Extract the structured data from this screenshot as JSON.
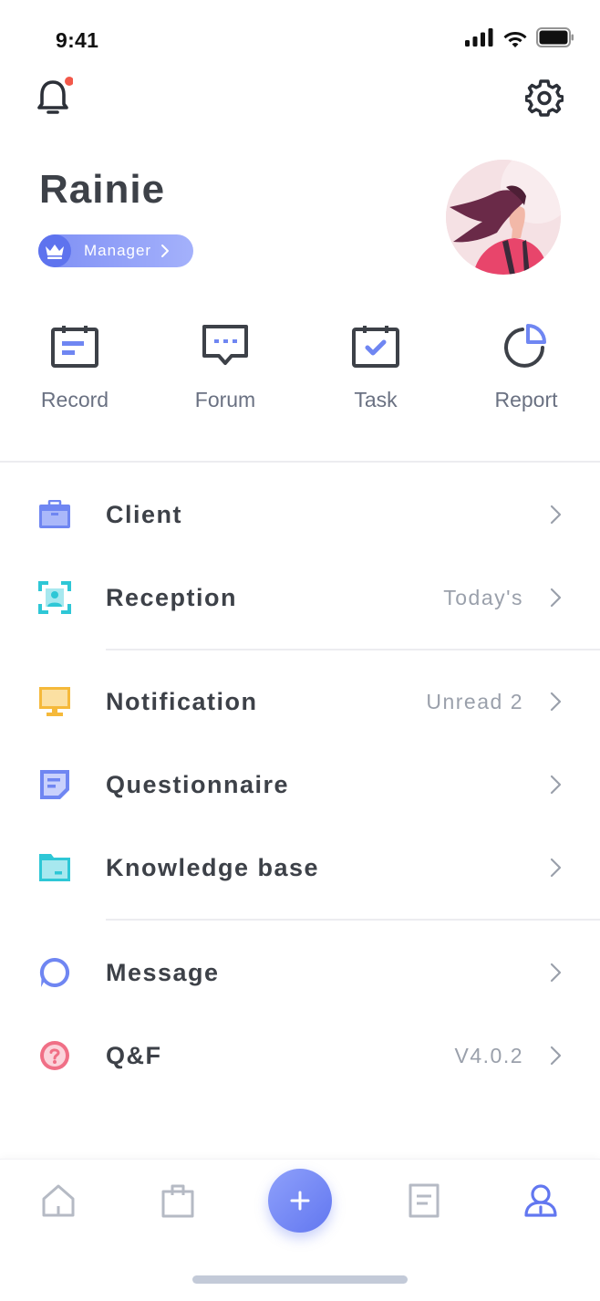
{
  "status_bar": {
    "time": "9:41"
  },
  "profile": {
    "name": "Rainie",
    "role": "Manager"
  },
  "quick_actions": [
    {
      "label": "Record",
      "icon": "calendar-record-icon"
    },
    {
      "label": "Forum",
      "icon": "chat-bubble-icon"
    },
    {
      "label": "Task",
      "icon": "calendar-check-icon"
    },
    {
      "label": "Report",
      "icon": "pie-chart-icon"
    }
  ],
  "menu": [
    {
      "label": "Client",
      "value": "",
      "icon": "briefcase-icon",
      "color": "#6f86f2"
    },
    {
      "label": "Reception",
      "value": "Today's",
      "icon": "face-scan-icon",
      "color": "#2ec7d6"
    },
    {
      "label": "Notification",
      "value": "Unread 2",
      "icon": "monitor-icon",
      "color": "#f5b93a"
    },
    {
      "label": "Questionnaire",
      "value": "",
      "icon": "note-icon",
      "color": "#6f86f2"
    },
    {
      "label": "Knowledge base",
      "value": "",
      "icon": "folder-icon",
      "color": "#2ec7d6"
    },
    {
      "label": "Message",
      "value": "",
      "icon": "message-circle-icon",
      "color": "#6f86f2"
    },
    {
      "label": "Q&F",
      "value": "V4.0.2",
      "icon": "question-circle-icon",
      "color": "#f06f86"
    }
  ],
  "tabbar": {
    "tabs": [
      "home-icon",
      "bag-icon",
      "add-icon",
      "document-icon",
      "profile-icon"
    ],
    "active": "profile-icon",
    "accent": "#6277f0"
  }
}
